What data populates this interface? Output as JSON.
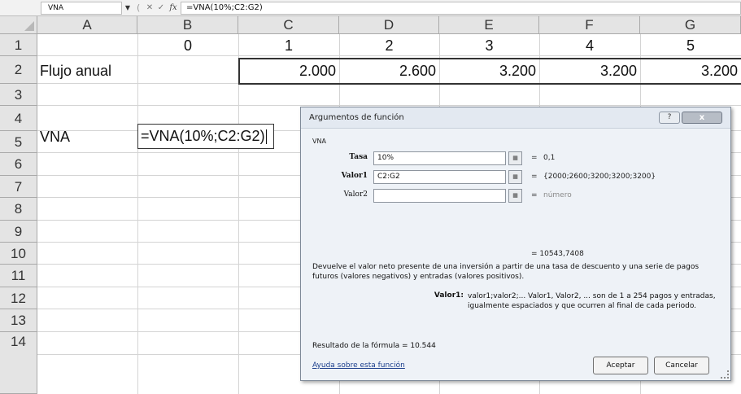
{
  "formula_bar": {
    "name_box": "VNA",
    "formula": "=VNA(10%;C2:G2)",
    "fx_label": "fx",
    "cancel_glyph": "✕",
    "enter_glyph": "✓"
  },
  "sheet": {
    "columns": [
      "A",
      "B",
      "C",
      "D",
      "E",
      "F",
      "G"
    ],
    "rows": [
      "1",
      "2",
      "3",
      "4",
      "5",
      "6",
      "7",
      "8",
      "9",
      "10",
      "11",
      "12",
      "13",
      "14"
    ],
    "cells": {
      "B1": "0",
      "C1": "1",
      "D1": "2",
      "E1": "3",
      "F1": "4",
      "G1": "5",
      "A2": "Flujo anual",
      "C2": "2.000",
      "D2": "2.600",
      "E2": "3.200",
      "F2": "3.200",
      "G2": "3.200",
      "A4": "VNA",
      "B4": "=VNA(10%;C2:G2)"
    }
  },
  "dialog": {
    "title": "Argumentos de función",
    "help_glyph": "?",
    "close_glyph": "x",
    "function_name": "VNA",
    "args": [
      {
        "label": "Tasa",
        "value": "10%",
        "result": "0,1",
        "bold": true
      },
      {
        "label": "Valor1",
        "value": "C2:G2",
        "result": "{2000;2600;3200;3200;3200}",
        "bold": true
      },
      {
        "label": "Valor2",
        "value": "",
        "result": "número",
        "bold": false
      }
    ],
    "eq": "=",
    "ref_glyph": "▦",
    "preview_result": "=  10543,7408",
    "description": "Devuelve el valor neto presente de una inversión a partir de una tasa de descuento y una serie de pagos futuros (valores negativos) y entradas (valores positivos).",
    "param_name": "Valor1:",
    "param_description": "valor1;valor2;... Valor1, Valor2, ... son de 1 a 254 pagos y entradas, igualmente espaciados y que ocurren al final de cada periodo.",
    "result_line": "Resultado de la fórmula =   10.544",
    "help_link": "Ayuda sobre esta función",
    "ok_label": "Aceptar",
    "cancel_label": "Cancelar"
  }
}
